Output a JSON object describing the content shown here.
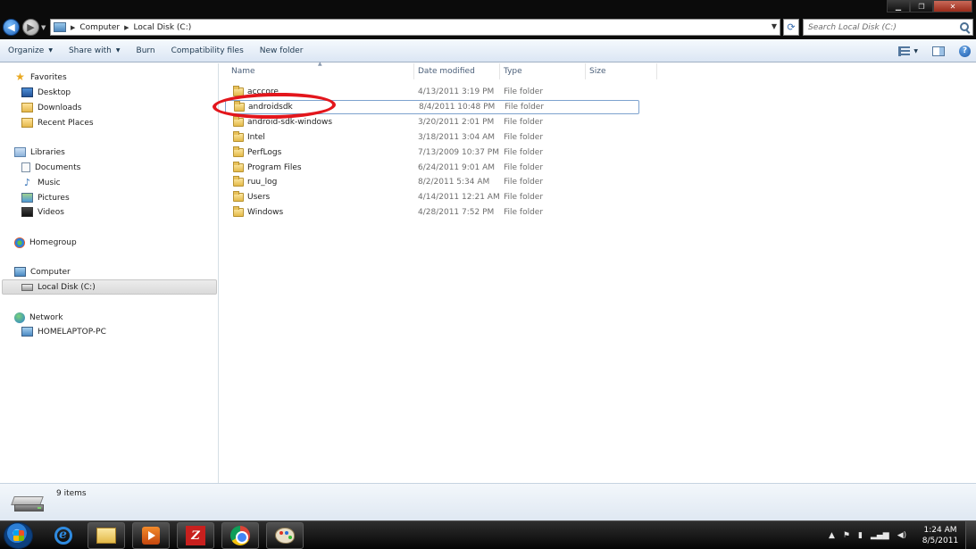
{
  "address": {
    "segments": [
      "Computer",
      "Local Disk (C:)"
    ],
    "search_placeholder": "Search Local Disk (C:)"
  },
  "toolbar": {
    "organize": "Organize",
    "share_with": "Share with",
    "burn": "Burn",
    "compatibility_files": "Compatibility files",
    "new_folder": "New folder"
  },
  "sidebar": {
    "favorites": "Favorites",
    "desktop": "Desktop",
    "downloads": "Downloads",
    "recent_places": "Recent Places",
    "libraries": "Libraries",
    "documents": "Documents",
    "music": "Music",
    "pictures": "Pictures",
    "videos": "Videos",
    "homegroup": "Homegroup",
    "computer": "Computer",
    "local_disk": "Local Disk (C:)",
    "network": "Network",
    "homelaptop": "HOMELAPTOP-PC"
  },
  "columns": {
    "name": "Name",
    "date_modified": "Date modified",
    "type": "Type",
    "size": "Size"
  },
  "files": [
    {
      "name": "acccore",
      "date": "4/13/2011 3:19 PM",
      "type": "File folder"
    },
    {
      "name": "androidsdk",
      "date": "8/4/2011 10:48 PM",
      "type": "File folder"
    },
    {
      "name": "android-sdk-windows",
      "date": "3/20/2011 2:01 PM",
      "type": "File folder"
    },
    {
      "name": "Intel",
      "date": "3/18/2011 3:04 AM",
      "type": "File folder"
    },
    {
      "name": "PerfLogs",
      "date": "7/13/2009 10:37 PM",
      "type": "File folder"
    },
    {
      "name": "Program Files",
      "date": "6/24/2011 9:01 AM",
      "type": "File folder"
    },
    {
      "name": "ruu_log",
      "date": "8/2/2011 5:34 AM",
      "type": "File folder"
    },
    {
      "name": "Users",
      "date": "4/14/2011 12:21 AM",
      "type": "File folder"
    },
    {
      "name": "Windows",
      "date": "4/28/2011 7:52 PM",
      "type": "File folder"
    }
  ],
  "status": {
    "item_count": "9 items"
  },
  "taskbar": {
    "time": "1:24 AM",
    "date": "8/5/2011",
    "apps": [
      "internet-explorer-icon",
      "windows-explorer-icon",
      "media-player-icon",
      "filezilla-icon",
      "chrome-icon",
      "paint-icon"
    ]
  },
  "colors": {
    "annotation": "#e3161c",
    "selection_border": "#7da2ce",
    "command_bar": "#dbe6f4"
  }
}
